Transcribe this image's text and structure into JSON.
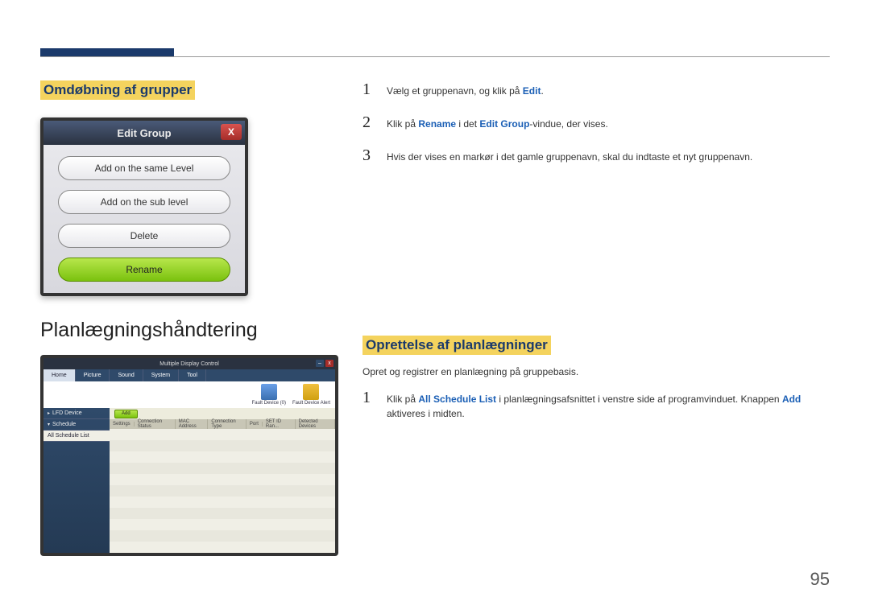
{
  "page_number": "95",
  "section1_title": "Omdøbning af grupper",
  "dialog": {
    "title": "Edit Group",
    "close_label": "X",
    "btn_same": "Add on the same Level",
    "btn_sub": "Add on the sub level",
    "btn_delete": "Delete",
    "btn_rename": "Rename"
  },
  "steps_top": [
    {
      "num": "1",
      "parts": [
        {
          "t": "Vælg et gruppenavn, og klik på "
        },
        {
          "t": "Edit",
          "cls": "bold-blue"
        },
        {
          "t": "."
        }
      ]
    },
    {
      "num": "2",
      "parts": [
        {
          "t": "Klik på "
        },
        {
          "t": "Rename",
          "cls": "bold-blue"
        },
        {
          "t": " i det "
        },
        {
          "t": "Edit Group",
          "cls": "bold-blue"
        },
        {
          "t": "-vindue, der vises."
        }
      ]
    },
    {
      "num": "3",
      "parts": [
        {
          "t": "Hvis der vises en markør i det gamle gruppenavn, skal du indtaste et nyt gruppenavn."
        }
      ]
    }
  ],
  "big_title": "Planlægningshåndtering",
  "section2_title": "Oprettelse af planlægninger",
  "section2_desc": "Opret og registrer en planlægning på gruppebasis.",
  "steps_bot": [
    {
      "num": "1",
      "parts": [
        {
          "t": "Klik på "
        },
        {
          "t": "All Schedule List",
          "cls": "bold-blue"
        },
        {
          "t": " i planlægningsafsnittet i venstre side af programvinduet. Knappen "
        },
        {
          "t": "Add",
          "cls": "bold-blue"
        },
        {
          "t": " aktiveres i midten."
        }
      ]
    }
  ],
  "mdc": {
    "window_title": "Multiple Display Control",
    "tabs": [
      "Home",
      "Picture",
      "Sound",
      "System",
      "Tool"
    ],
    "rib1": "Fault Device (0)",
    "rib2": "Fault Device Alert",
    "side": {
      "lfd": "LFD Device",
      "schedule": "Schedule",
      "all_schedule": "All Schedule List"
    },
    "add_btn": "Add",
    "headers": [
      "Settings",
      "Connection Status",
      "MAC Address",
      "Connection Type",
      "Port",
      "SET ID Ran...",
      "Detected Devices"
    ]
  }
}
